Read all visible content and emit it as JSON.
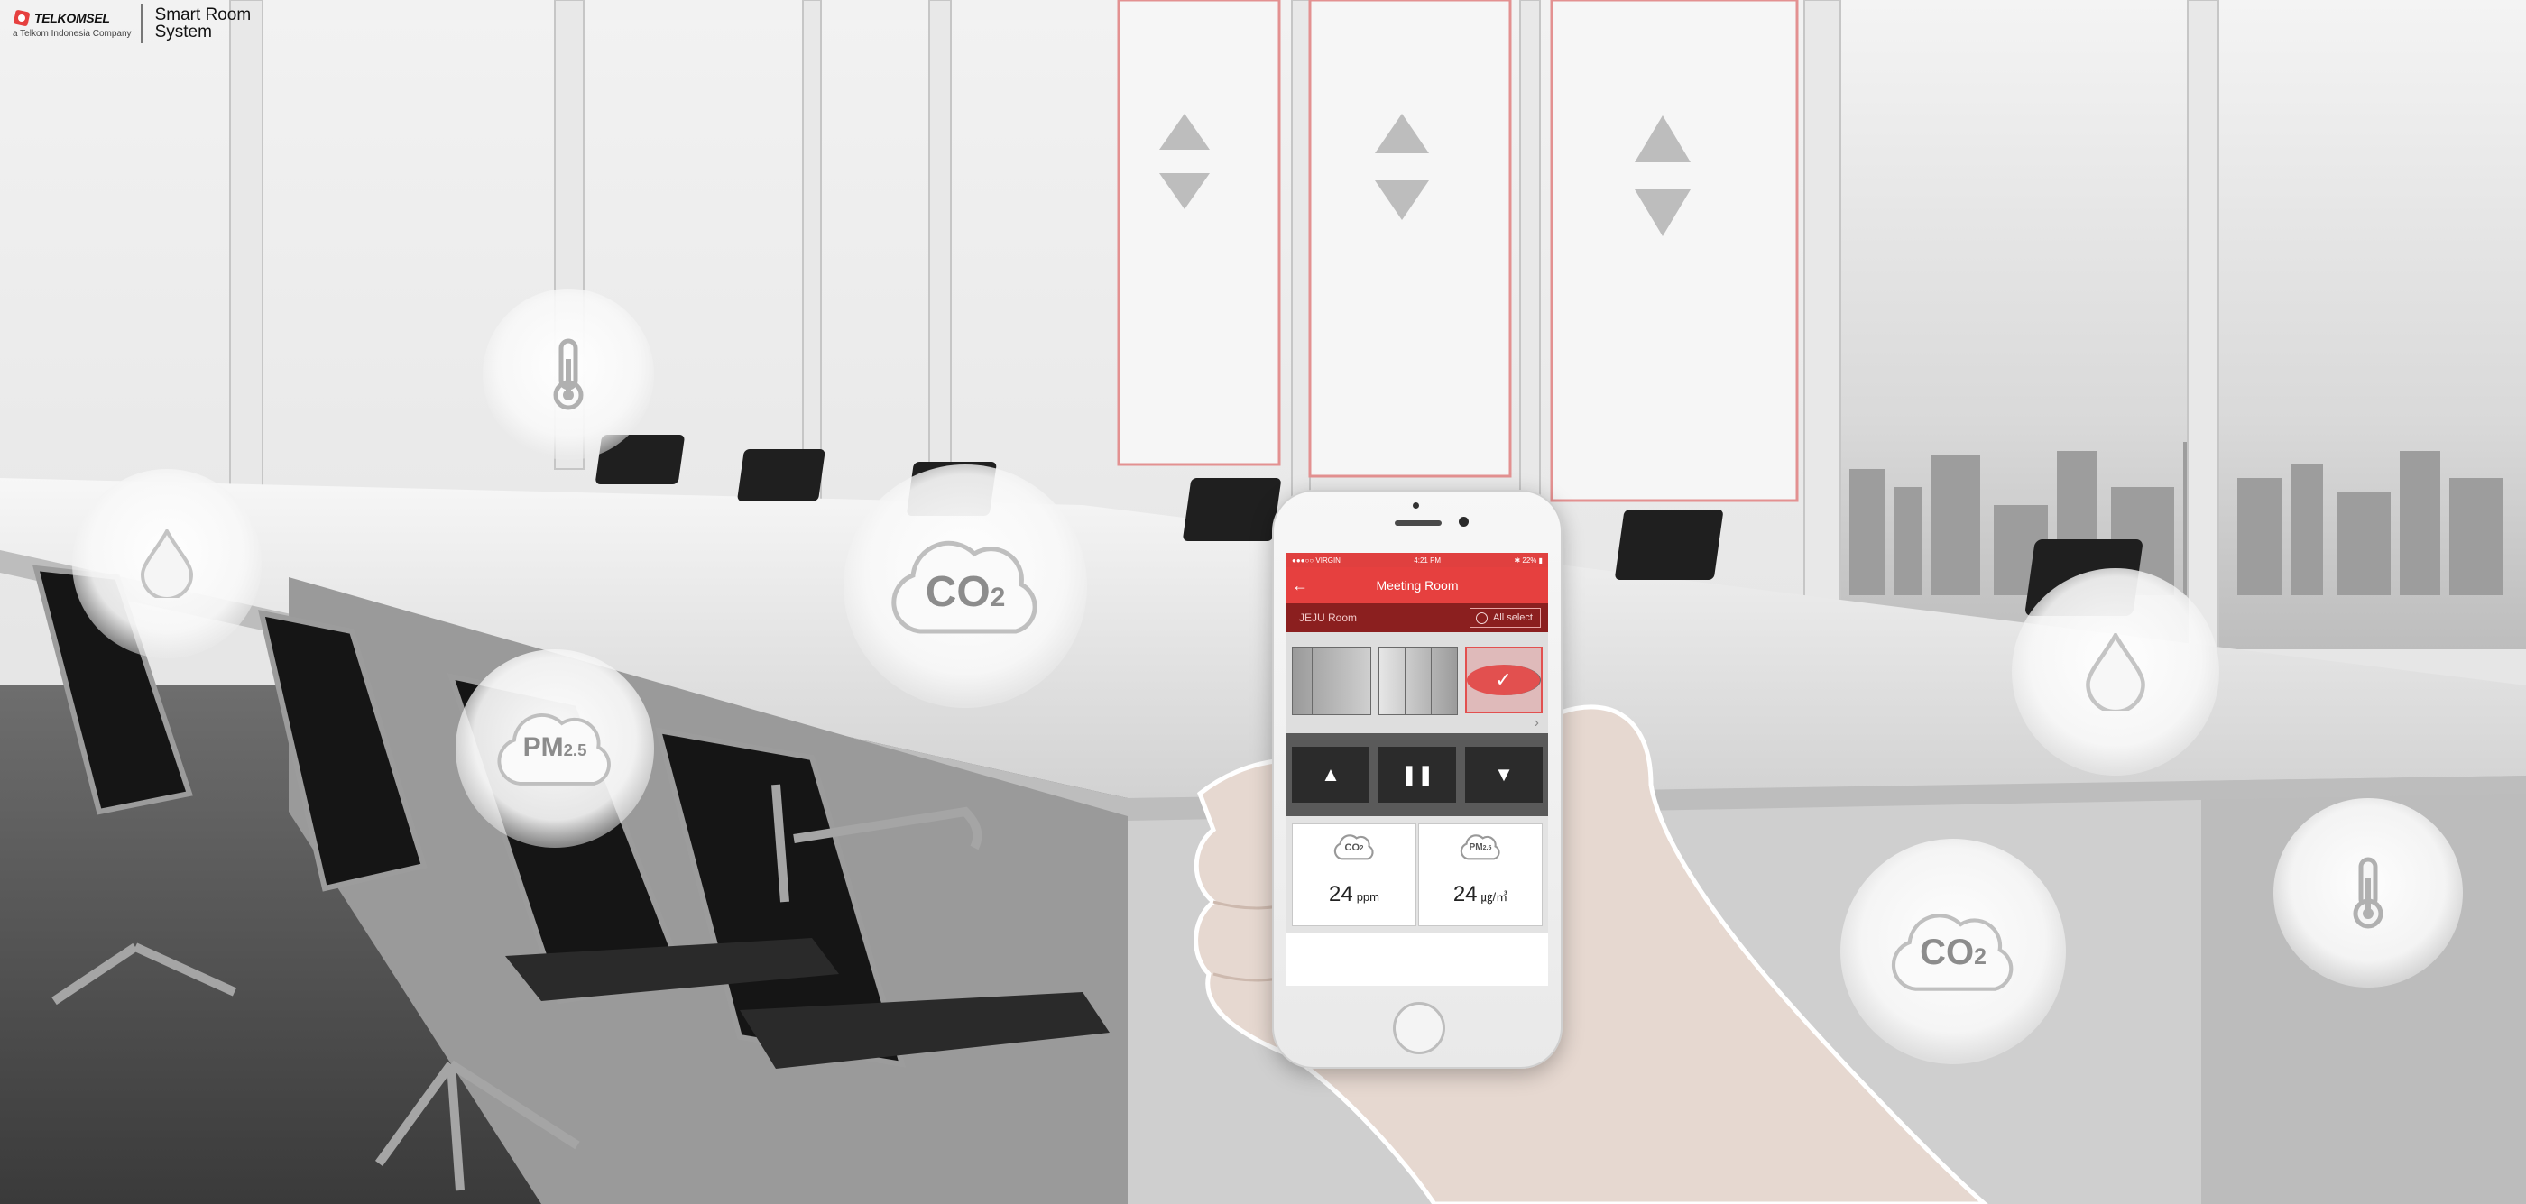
{
  "logo": {
    "brand": "TELKOMSEL",
    "tagline": "a Telkom Indonesia Company",
    "product_line1": "Smart Room",
    "product_line2": "System"
  },
  "scene_bubbles": {
    "co2_label": "CO",
    "co2_sub": "2",
    "pm_label": "PM",
    "pm_sub": "2.5",
    "icons": [
      "thermometer-icon",
      "water-drop-icon"
    ]
  },
  "phone": {
    "status": {
      "carrier": "●●●○○ VIRGIN",
      "time": "4:21 PM",
      "battery": "✱ 22% ▮"
    },
    "title": "Meeting Room",
    "room": "JEJU Room",
    "all_select": "All select",
    "controls": {
      "up": "▲",
      "pause": "❚❚",
      "down": "▼"
    },
    "sensors": [
      {
        "label": "CO",
        "sub": "2",
        "value": "24",
        "unit": "ppm"
      },
      {
        "label": "PM",
        "sub": "2.5",
        "value": "24",
        "unit": "㎍/㎥"
      }
    ]
  },
  "colors": {
    "accent": "#e6403f",
    "accent_dark": "#8b1f1f",
    "bubble_text": "#8c8c8c"
  }
}
